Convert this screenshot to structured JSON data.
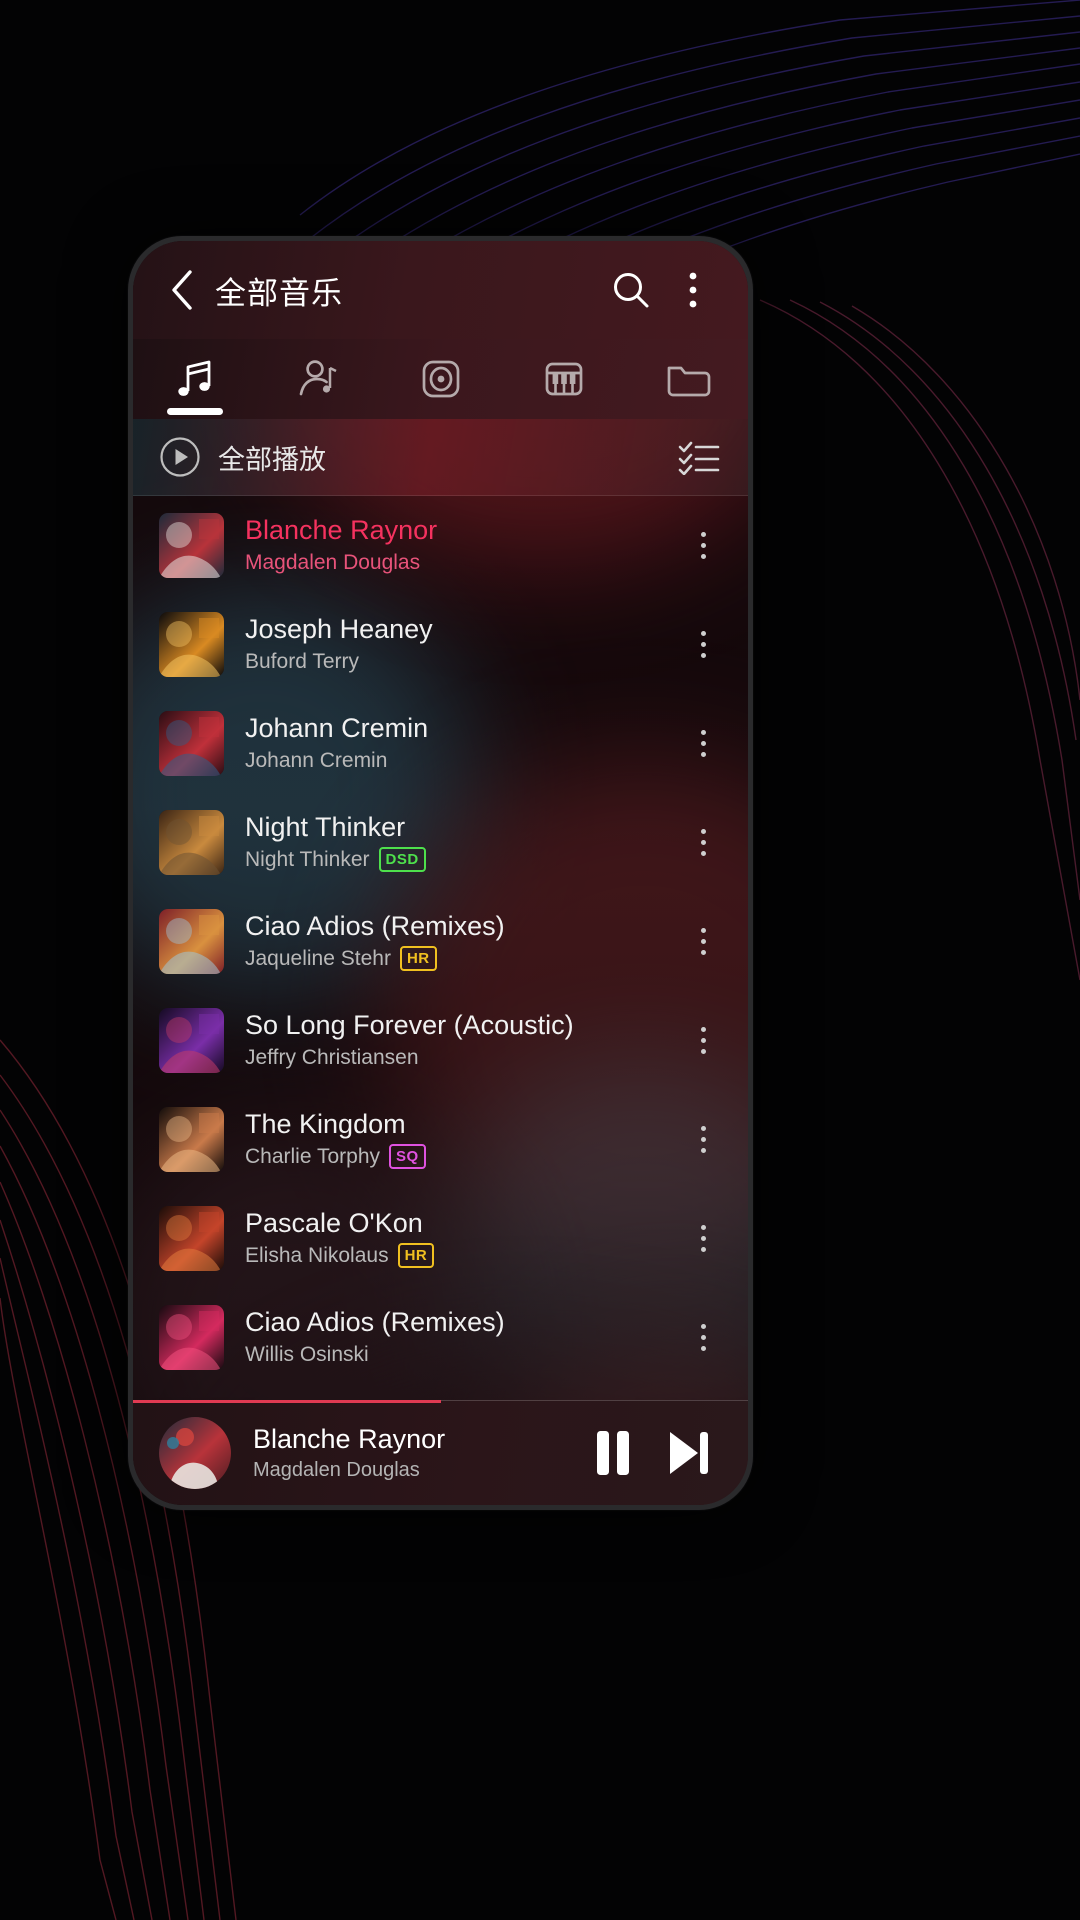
{
  "app": {
    "header": {
      "title": "全部音乐",
      "back_icon": "chevron-left-icon",
      "search_icon": "search-icon",
      "overflow_icon": "more-vertical-icon"
    },
    "tabs": [
      {
        "id": "songs",
        "icon": "music-note-icon",
        "active": true
      },
      {
        "id": "artists",
        "icon": "artist-icon",
        "active": false
      },
      {
        "id": "albums",
        "icon": "album-disc-icon",
        "active": false
      },
      {
        "id": "genres",
        "icon": "piano-keys-icon",
        "active": false
      },
      {
        "id": "folders",
        "icon": "folder-icon",
        "active": false
      }
    ],
    "play_all": {
      "label": "全部播放",
      "play_icon": "play-circle-icon",
      "select_icon": "multi-select-icon"
    },
    "songs": [
      {
        "title": "Blanche Raynor",
        "artist": "Magdalen Douglas",
        "badge": "",
        "playing": true,
        "art": {
          "a": "#1d2b3a",
          "b": "#b8333a",
          "c": "#e8e4e0"
        }
      },
      {
        "title": "Joseph Heaney",
        "artist": "Buford Terry",
        "badge": "",
        "playing": false,
        "art": {
          "a": "#0a0a0c",
          "b": "#d98a22",
          "c": "#f2c261"
        }
      },
      {
        "title": "Johann Cremin",
        "artist": "Johann Cremin",
        "badge": "",
        "playing": false,
        "art": {
          "a": "#2a0d14",
          "b": "#c0303a",
          "c": "#2f5f8a"
        }
      },
      {
        "title": "Night Thinker",
        "artist": "Night Thinker",
        "badge": "DSD",
        "playing": false,
        "art": {
          "a": "#3a2414",
          "b": "#c98a3e",
          "c": "#6d5233"
        }
      },
      {
        "title": "Ciao Adios (Remixes)",
        "artist": "Jaqueline Stehr",
        "badge": "HR",
        "playing": false,
        "art": {
          "a": "#7d1f28",
          "b": "#d9913f",
          "c": "#9fc4d6"
        }
      },
      {
        "title": "So Long Forever (Acoustic)",
        "artist": "Jeffry Christiansen",
        "badge": "",
        "playing": false,
        "art": {
          "a": "#140a22",
          "b": "#7a2ea8",
          "c": "#c23a66"
        }
      },
      {
        "title": "The Kingdom",
        "artist": "Charlie Torphy",
        "badge": "SQ",
        "playing": false,
        "art": {
          "a": "#120c0a",
          "b": "#c97a4a",
          "c": "#e9b684"
        }
      },
      {
        "title": "Pascale O'Kon",
        "artist": "Elisha Nikolaus",
        "badge": "HR",
        "playing": false,
        "art": {
          "a": "#1a0c08",
          "b": "#c4442a",
          "c": "#e07a3c"
        }
      },
      {
        "title": "Ciao Adios (Remixes)",
        "artist": "Willis Osinski",
        "badge": "",
        "playing": false,
        "art": {
          "a": "#160a10",
          "b": "#d42a5e",
          "c": "#f0507e"
        }
      }
    ],
    "badge_colors": {
      "DSD": "#4ee04c",
      "HR": "#f0c020",
      "SQ": "#e052e0"
    },
    "now_playing": {
      "title": "Blanche Raynor",
      "artist": "Magdalen Douglas",
      "pause_icon": "pause-icon",
      "next_icon": "skip-next-icon",
      "progress_percent": 50
    }
  }
}
